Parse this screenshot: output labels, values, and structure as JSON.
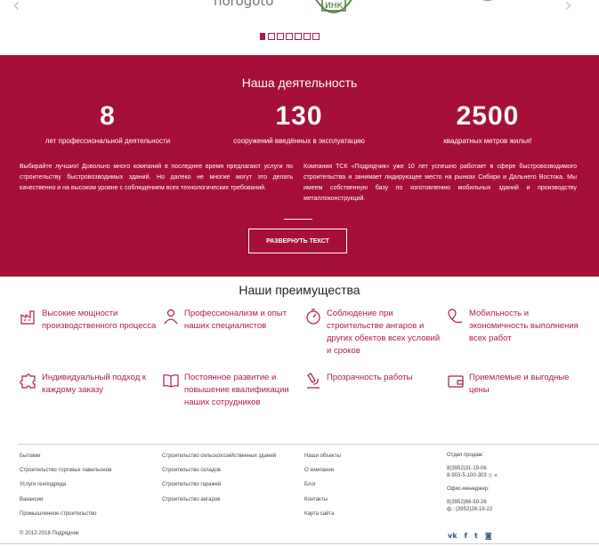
{
  "carousel": {
    "prev_icon": "chevron-left-icon",
    "next_icon": "chevron-right-icon",
    "logo_text": "norogoto",
    "slides_count": 7,
    "active_slide": 1
  },
  "activity": {
    "title": "Наша деятельность",
    "stats": [
      {
        "number": "8",
        "label": "лет профессиональной деятельности"
      },
      {
        "number": "130",
        "label": "сооружений введённых в эксплуатацию"
      },
      {
        "number": "2500",
        "label": "квадратных метров жилья!"
      }
    ],
    "paragraph_left": "Выбирайте лучших! Довольно много компаний в последнее время предлагают услуги по строительству быстровозводимых зданий. Но далеко не многие могут это делать качественно и на высоком уровне с соблюдением всех технологических требований.",
    "paragraph_right": "Компания ТСК «Подрядчик» уже 10 лет успешно работает в сфере быстровозводимого строительства и занимает лидирующее место на рынках Сибири и Дальнего Востока. Мы имеем собственную базу по изготовлению мобильных зданий и производству металлоконструкций.",
    "expand_button": "РАЗВЕРНУТЬ ТЕКСТ",
    "accent_color": "#a50f38"
  },
  "advantages": {
    "title": "Наши преимущества",
    "items": [
      {
        "icon": "factory-icon",
        "text": "Высокие мощности производственного процесса"
      },
      {
        "icon": "people-icon",
        "text": "Профессионализм и опыт наших специалистов"
      },
      {
        "icon": "stopwatch-icon",
        "text": "Соблюдение при строительстве ангаров и других обектов всех условий и сроков"
      },
      {
        "icon": "map-pin-icon",
        "text": "Мобильность и экономичность выполнения всех работ"
      },
      {
        "icon": "puzzle-icon",
        "text": "Индивидуальный подход к каждому заказу"
      },
      {
        "icon": "book-icon",
        "text": "Постоянное развитие и повышение квалификации наших сотрудников"
      },
      {
        "icon": "microscope-icon",
        "text": "Прозрачность работы"
      },
      {
        "icon": "wallet-icon",
        "text": "Приемлемые и выгодные цены"
      }
    ]
  },
  "footer": {
    "col1": [
      "Бытовки",
      "Строительство торговых павильонов",
      "Услуги генподряда",
      "Вакансии",
      "Промышленное строительство"
    ],
    "col2": [
      "Строительство сельскохозяйственных зданий",
      "Строительство складов",
      "Строительство гаражей",
      "Строительство ангаров"
    ],
    "col3": [
      "Наши объекты",
      "О компании",
      "Блог",
      "Контакты",
      "Карта сайта"
    ],
    "sales_label": "Отдел продаж:",
    "sales_phones": [
      "8(3952)31-19-06",
      "8-903-5-100-303"
    ],
    "office_label": "Офис-менеджер:",
    "office_phones": [
      "8(3952)66-50-26",
      "ф.: (3952)28-19-22"
    ],
    "copyright": "© 2012-2018 Подрядчик",
    "socials": [
      "vk-icon",
      "facebook-icon",
      "twitter-icon",
      "instagram-icon"
    ]
  }
}
